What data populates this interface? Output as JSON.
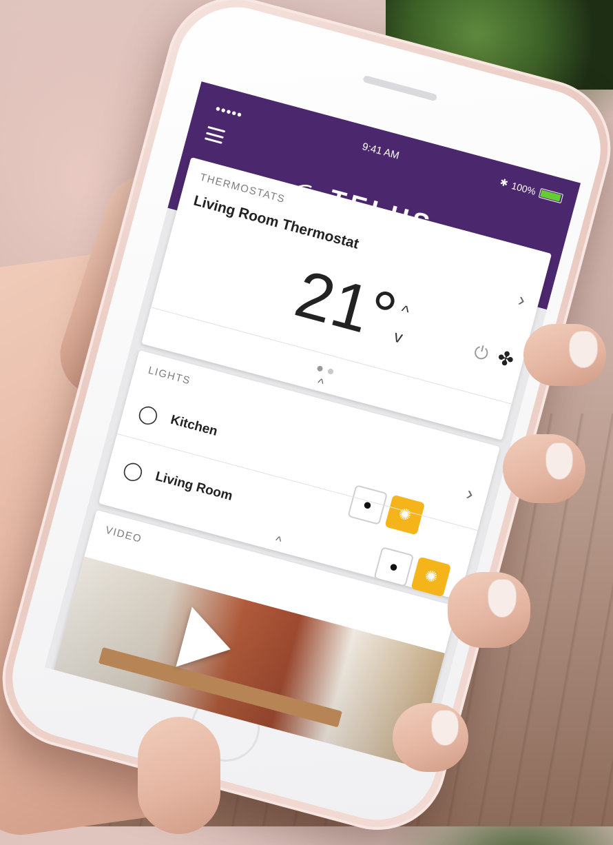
{
  "status_bar": {
    "signal": "•••••",
    "time": "9:41 AM",
    "battery": "100%"
  },
  "header": {
    "brand": "TELUS",
    "brand_color": "#4b286d"
  },
  "thermostats": {
    "section_title": "THERMOSTATS",
    "name": "Living Room Thermostat",
    "temperature": "21°",
    "icons": [
      "power-icon",
      "fan-icon"
    ]
  },
  "lights": {
    "section_title": "LIGHTS",
    "items": [
      {
        "label": "Kitchen"
      },
      {
        "label": "Living Room"
      }
    ],
    "on_color": "#f5b51a"
  },
  "video": {
    "section_title": "VIDEO"
  }
}
